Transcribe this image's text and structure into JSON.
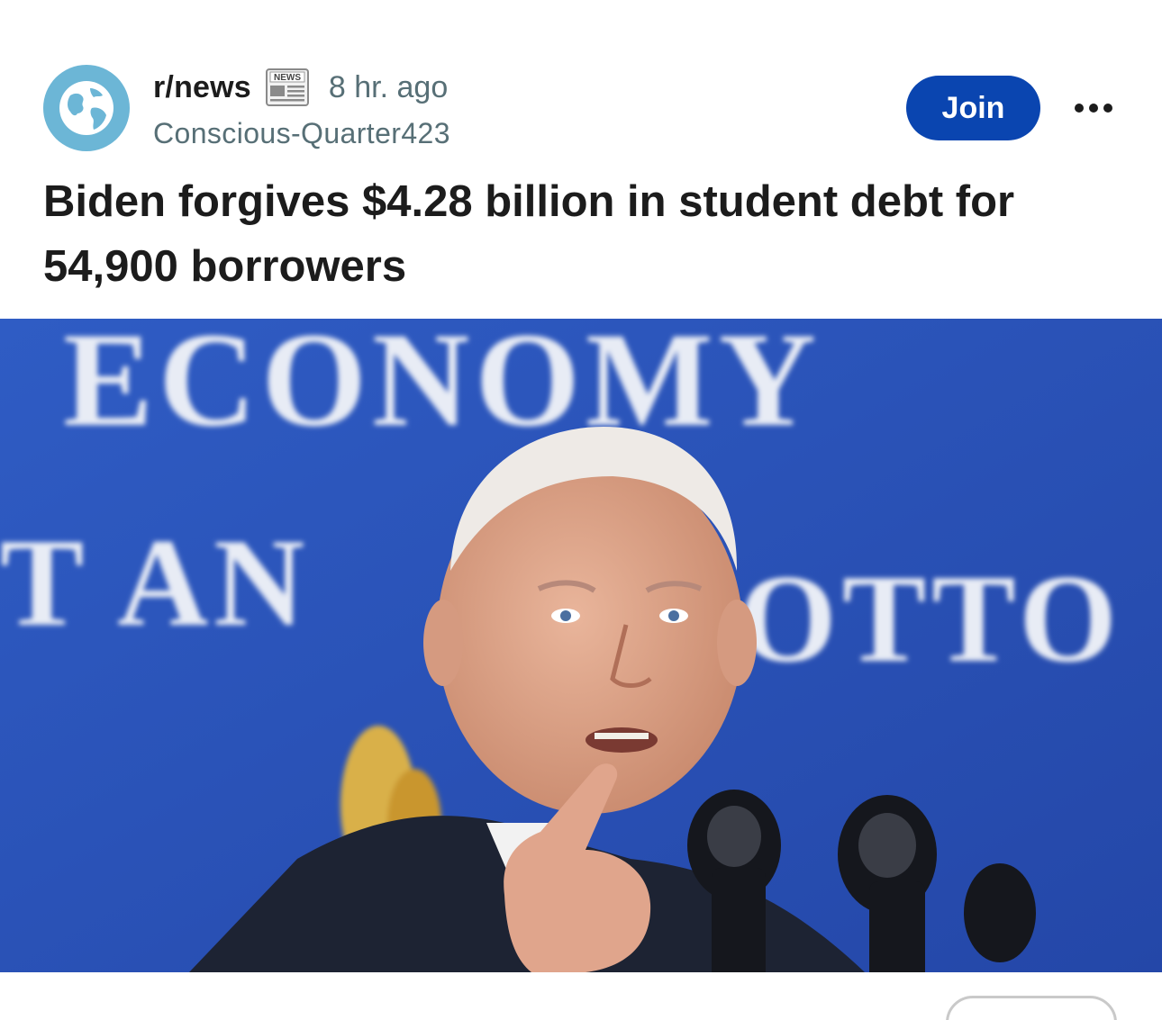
{
  "post": {
    "subreddit": "r/news",
    "subreddit_icon": "globe-icon",
    "flair_icon": "newspaper-emoji-icon",
    "flair_icon_text": "NEWS",
    "time_ago": "8 hr. ago",
    "author": "Conscious-Quarter423",
    "join_label": "Join",
    "more_icon": "more-options-icon",
    "title": "Biden forgives $4.28 billion in student debt for 54,900 borrowers",
    "image": {
      "alt_scene": "photo",
      "background_sign_text": [
        "ECONOMY",
        "T AN",
        "OTTO"
      ]
    }
  },
  "colors": {
    "join_bg": "#0a45b0",
    "avatar_bg": "#6cb6d6",
    "meta_text": "#576f76",
    "title_text": "#1c1c1c",
    "sign_bg": "#2a52b8"
  }
}
